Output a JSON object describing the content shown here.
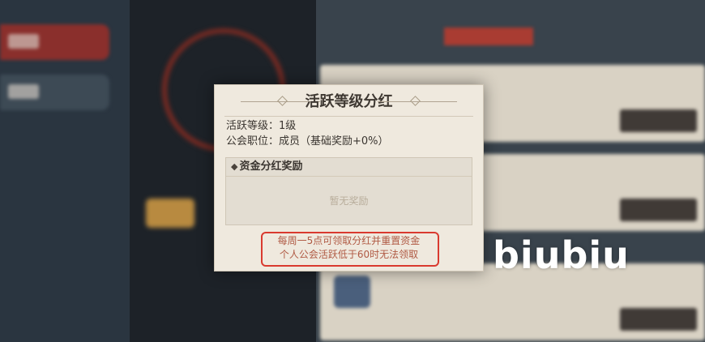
{
  "dialog": {
    "title": "活跃等级分红",
    "activity_level": "活跃等级：1级",
    "guild_position": "公会职位：成员（基础奖励+0%）",
    "section": {
      "icon": "diamond-icon",
      "title": "资金分红奖励",
      "empty_text": "暂无奖励"
    },
    "notes": [
      "每周一5点可领取分红并重置资金",
      "个人公会活跃低于60时无法领取"
    ]
  },
  "watermark": "biubiu",
  "colors": {
    "dialog_bg": "#efe9de",
    "highlight_border": "#d93a2f",
    "note_text": "#b05a44",
    "active_tab": "#8a2f2c"
  }
}
